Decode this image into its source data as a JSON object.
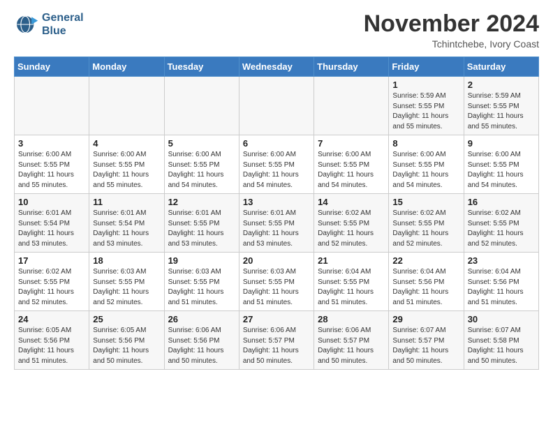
{
  "header": {
    "logo_line1": "General",
    "logo_line2": "Blue",
    "month": "November 2024",
    "location": "Tchintchebe, Ivory Coast"
  },
  "weekdays": [
    "Sunday",
    "Monday",
    "Tuesday",
    "Wednesday",
    "Thursday",
    "Friday",
    "Saturday"
  ],
  "weeks": [
    [
      {
        "day": "",
        "info": ""
      },
      {
        "day": "",
        "info": ""
      },
      {
        "day": "",
        "info": ""
      },
      {
        "day": "",
        "info": ""
      },
      {
        "day": "",
        "info": ""
      },
      {
        "day": "1",
        "info": "Sunrise: 5:59 AM\nSunset: 5:55 PM\nDaylight: 11 hours\nand 55 minutes."
      },
      {
        "day": "2",
        "info": "Sunrise: 5:59 AM\nSunset: 5:55 PM\nDaylight: 11 hours\nand 55 minutes."
      }
    ],
    [
      {
        "day": "3",
        "info": "Sunrise: 6:00 AM\nSunset: 5:55 PM\nDaylight: 11 hours\nand 55 minutes."
      },
      {
        "day": "4",
        "info": "Sunrise: 6:00 AM\nSunset: 5:55 PM\nDaylight: 11 hours\nand 55 minutes."
      },
      {
        "day": "5",
        "info": "Sunrise: 6:00 AM\nSunset: 5:55 PM\nDaylight: 11 hours\nand 54 minutes."
      },
      {
        "day": "6",
        "info": "Sunrise: 6:00 AM\nSunset: 5:55 PM\nDaylight: 11 hours\nand 54 minutes."
      },
      {
        "day": "7",
        "info": "Sunrise: 6:00 AM\nSunset: 5:55 PM\nDaylight: 11 hours\nand 54 minutes."
      },
      {
        "day": "8",
        "info": "Sunrise: 6:00 AM\nSunset: 5:55 PM\nDaylight: 11 hours\nand 54 minutes."
      },
      {
        "day": "9",
        "info": "Sunrise: 6:00 AM\nSunset: 5:55 PM\nDaylight: 11 hours\nand 54 minutes."
      }
    ],
    [
      {
        "day": "10",
        "info": "Sunrise: 6:01 AM\nSunset: 5:54 PM\nDaylight: 11 hours\nand 53 minutes."
      },
      {
        "day": "11",
        "info": "Sunrise: 6:01 AM\nSunset: 5:54 PM\nDaylight: 11 hours\nand 53 minutes."
      },
      {
        "day": "12",
        "info": "Sunrise: 6:01 AM\nSunset: 5:55 PM\nDaylight: 11 hours\nand 53 minutes."
      },
      {
        "day": "13",
        "info": "Sunrise: 6:01 AM\nSunset: 5:55 PM\nDaylight: 11 hours\nand 53 minutes."
      },
      {
        "day": "14",
        "info": "Sunrise: 6:02 AM\nSunset: 5:55 PM\nDaylight: 11 hours\nand 52 minutes."
      },
      {
        "day": "15",
        "info": "Sunrise: 6:02 AM\nSunset: 5:55 PM\nDaylight: 11 hours\nand 52 minutes."
      },
      {
        "day": "16",
        "info": "Sunrise: 6:02 AM\nSunset: 5:55 PM\nDaylight: 11 hours\nand 52 minutes."
      }
    ],
    [
      {
        "day": "17",
        "info": "Sunrise: 6:02 AM\nSunset: 5:55 PM\nDaylight: 11 hours\nand 52 minutes."
      },
      {
        "day": "18",
        "info": "Sunrise: 6:03 AM\nSunset: 5:55 PM\nDaylight: 11 hours\nand 52 minutes."
      },
      {
        "day": "19",
        "info": "Sunrise: 6:03 AM\nSunset: 5:55 PM\nDaylight: 11 hours\nand 51 minutes."
      },
      {
        "day": "20",
        "info": "Sunrise: 6:03 AM\nSunset: 5:55 PM\nDaylight: 11 hours\nand 51 minutes."
      },
      {
        "day": "21",
        "info": "Sunrise: 6:04 AM\nSunset: 5:55 PM\nDaylight: 11 hours\nand 51 minutes."
      },
      {
        "day": "22",
        "info": "Sunrise: 6:04 AM\nSunset: 5:56 PM\nDaylight: 11 hours\nand 51 minutes."
      },
      {
        "day": "23",
        "info": "Sunrise: 6:04 AM\nSunset: 5:56 PM\nDaylight: 11 hours\nand 51 minutes."
      }
    ],
    [
      {
        "day": "24",
        "info": "Sunrise: 6:05 AM\nSunset: 5:56 PM\nDaylight: 11 hours\nand 51 minutes."
      },
      {
        "day": "25",
        "info": "Sunrise: 6:05 AM\nSunset: 5:56 PM\nDaylight: 11 hours\nand 50 minutes."
      },
      {
        "day": "26",
        "info": "Sunrise: 6:06 AM\nSunset: 5:56 PM\nDaylight: 11 hours\nand 50 minutes."
      },
      {
        "day": "27",
        "info": "Sunrise: 6:06 AM\nSunset: 5:57 PM\nDaylight: 11 hours\nand 50 minutes."
      },
      {
        "day": "28",
        "info": "Sunrise: 6:06 AM\nSunset: 5:57 PM\nDaylight: 11 hours\nand 50 minutes."
      },
      {
        "day": "29",
        "info": "Sunrise: 6:07 AM\nSunset: 5:57 PM\nDaylight: 11 hours\nand 50 minutes."
      },
      {
        "day": "30",
        "info": "Sunrise: 6:07 AM\nSunset: 5:58 PM\nDaylight: 11 hours\nand 50 minutes."
      }
    ]
  ]
}
